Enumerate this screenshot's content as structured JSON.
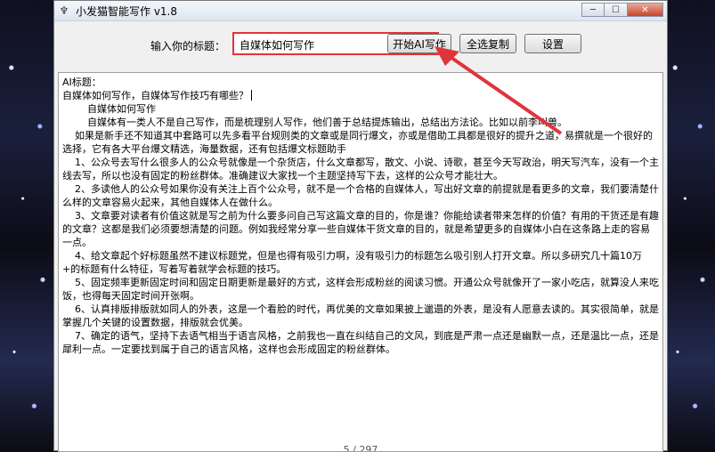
{
  "window": {
    "title": "小发猫智能写作 v1.8",
    "app_icon": "cat-logo-icon"
  },
  "toolbar": {
    "prompt_label": "输入你的标题：",
    "title_value": "自媒体如何写作",
    "start_label": "开始AI写作",
    "copy_label": "全选复制",
    "settings_label": "设置"
  },
  "content": {
    "lines": [
      "AI标题：",
      "自媒体如何写作，自媒体写作技巧有哪些？",
      "",
      "        自媒体如何写作",
      "        自媒体有一类人不是自己写作，而是梳理别人写作，他们善于总结提炼输出，总结出方法论。比如以前李叫兽。",
      "    如果是新手还不知道其中套路可以先多看平台规则类的文章或是同行爆文，亦或是借助工具都是很好的提升之道，易撰就是一个很好的选择，它有各大平台爆文精选，海量数据，还有包括爆文标题助手",
      "    1、公众号去写什么很多人的公众号就像是一个杂货店，什么文章都写，散文、小说、诗歌，甚至今天写政治，明天写汽车，没有一个主线去写，所以也没有固定的粉丝群体。准确建议大家找一个主题坚持写下去，这样的公众号才能壮大。",
      "    2、多读他人的公众号如果你没有关注上百个公众号，就不是一个合格的自媒体人，写出好文章的前提就是看更多的文章，我们要清楚什么样的文章容易火起来，其他自媒体人在做什么。",
      "    3、文章要对读者有价值这就是写之前为什么要多问自己写这篇文章的目的，你是谁？你能给读者带来怎样的价值？有用的干货还是有趣的文章？这都是我们必须要想清楚的问题。例如我经常分享一些自媒体干货文章的目的，就是希望更多的自媒体小白在这条路上走的容易一点。",
      "    4、给文章起个好标题虽然不建议标题党，但是也得有吸引力啊，没有吸引力的标题怎么吸引别人打开文章。所以多研究几十篇10万+的标题有什么特征，写着写着就学会标题的技巧。",
      "    5、固定频率更新固定时间和固定日期更新是最好的方式，这样会形成粉丝的阅读习惯。开通公众号就像开了一家小吃店，就算没人来吃饭，也得每天固定时间开张啊。",
      "    6、认真排版排版就如同人的外表，这是一个看脸的时代，再优美的文章如果披上邋遢的外表，是没有人愿意去读的。其实很简单，就是掌握几个关键的设置数据，排版就会优美。",
      "    7、确定的语气，坚持下去语气相当于语言风格，之前我也一直在纠结自己的文风，到底是严肃一点还是幽默一点，还是温比一点，还是犀利一点。一定要找到属于自己的语言风格，这样也会形成固定的粉丝群体。"
    ],
    "page_indicator": "5 / 297"
  },
  "colors": {
    "highlight": "#e0343c",
    "window_bg": "#f0f0f0"
  }
}
